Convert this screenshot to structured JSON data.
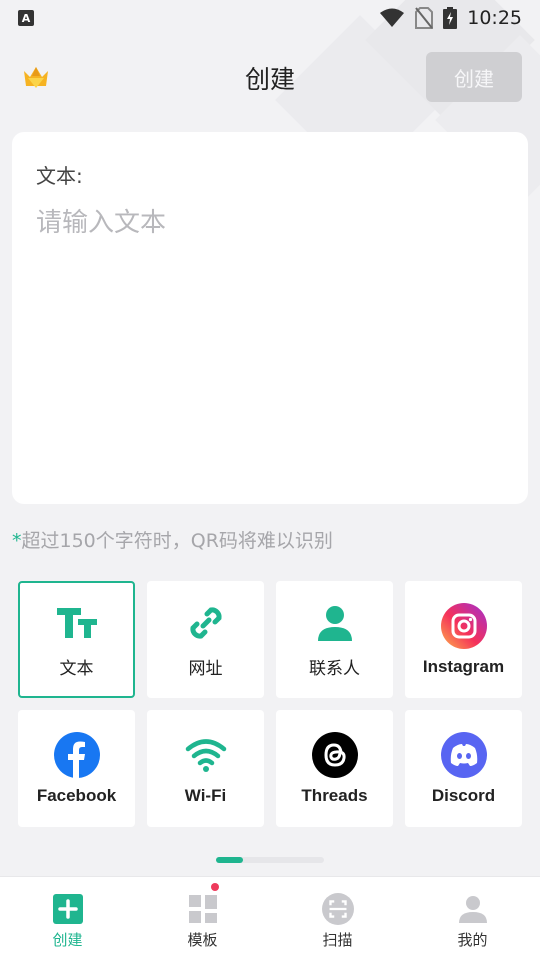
{
  "status_bar": {
    "time": "10:25",
    "keyboard_indicator": "A"
  },
  "header": {
    "title": "创建",
    "create_button": "创建"
  },
  "text_card": {
    "label": "文本:",
    "placeholder": "请输入文本",
    "value": ""
  },
  "hint": {
    "star": "*",
    "text": "超过150个字符时，QR码将难以识别"
  },
  "types": [
    {
      "label": "文本",
      "icon": "text-format-icon",
      "active": true
    },
    {
      "label": "网址",
      "icon": "link-icon"
    },
    {
      "label": "联系人",
      "icon": "contact-icon"
    },
    {
      "label": "Instagram",
      "icon": "instagram-icon"
    },
    {
      "label": "Facebook",
      "icon": "facebook-icon"
    },
    {
      "label": "Wi-Fi",
      "icon": "wifi-icon"
    },
    {
      "label": "Threads",
      "icon": "threads-icon"
    },
    {
      "label": "Discord",
      "icon": "discord-icon"
    }
  ],
  "pager": {
    "pages": 4,
    "current": 1
  },
  "bottom_nav": [
    {
      "label": "创建",
      "icon": "create-icon",
      "active": true
    },
    {
      "label": "模板",
      "icon": "template-icon",
      "badge": true
    },
    {
      "label": "扫描",
      "icon": "scan-icon"
    },
    {
      "label": "我的",
      "icon": "profile-icon"
    }
  ],
  "colors": {
    "accent": "#1fb58f",
    "badge": "#ee3a5b",
    "facebook": "#1877f2",
    "discord": "#5865f2"
  }
}
